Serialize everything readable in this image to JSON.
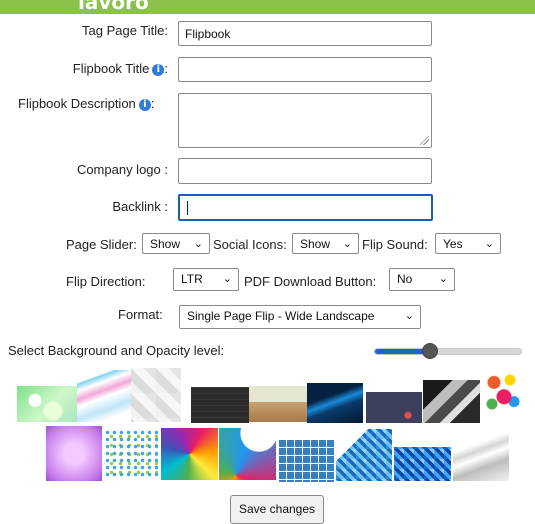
{
  "header": {
    "title": "lavoro"
  },
  "form": {
    "tag_title_label": "Tag Page Title:",
    "tag_title_value": "Flipbook",
    "flipbook_title_label": "Flipbook Title",
    "flipbook_title_suffix": ":",
    "flipbook_title_value": "",
    "description_label": "Flipbook Description",
    "description_suffix": ":",
    "description_value": "",
    "company_logo_label": "Company logo :",
    "company_logo_value": "",
    "backlink_label": "Backlink :",
    "backlink_value": "",
    "info_glyph": "i",
    "page_slider_label": "Page Slider:",
    "page_slider_value": "Show",
    "social_icons_label": "Social Icons:",
    "social_icons_value": "Show",
    "flip_sound_label": "Flip Sound:",
    "flip_sound_value": "Yes",
    "flip_direction_label": "Flip Direction:",
    "flip_direction_value": "LTR",
    "pdf_download_label": "PDF Download Button:",
    "pdf_download_value": "No",
    "format_label": "Format:",
    "format_value": "Single Page Flip - Wide Landscape",
    "background_label": "Select Background and Opacity level:",
    "opacity_level": 0.36,
    "save_label": "Save changes",
    "chevron": "⌄"
  },
  "backgrounds": [
    "green-bokeh",
    "blue-waves",
    "white-squares",
    "dark-brick",
    "wood-floor",
    "blue-light-streak",
    "navy-dots",
    "gray-geometric",
    "colorful-circles",
    "purple-glow",
    "color-dots",
    "triangle-mosaic",
    "color-swirls",
    "blue-tiles",
    "blue-cubes",
    "blue-diamonds",
    "white-swirl"
  ]
}
